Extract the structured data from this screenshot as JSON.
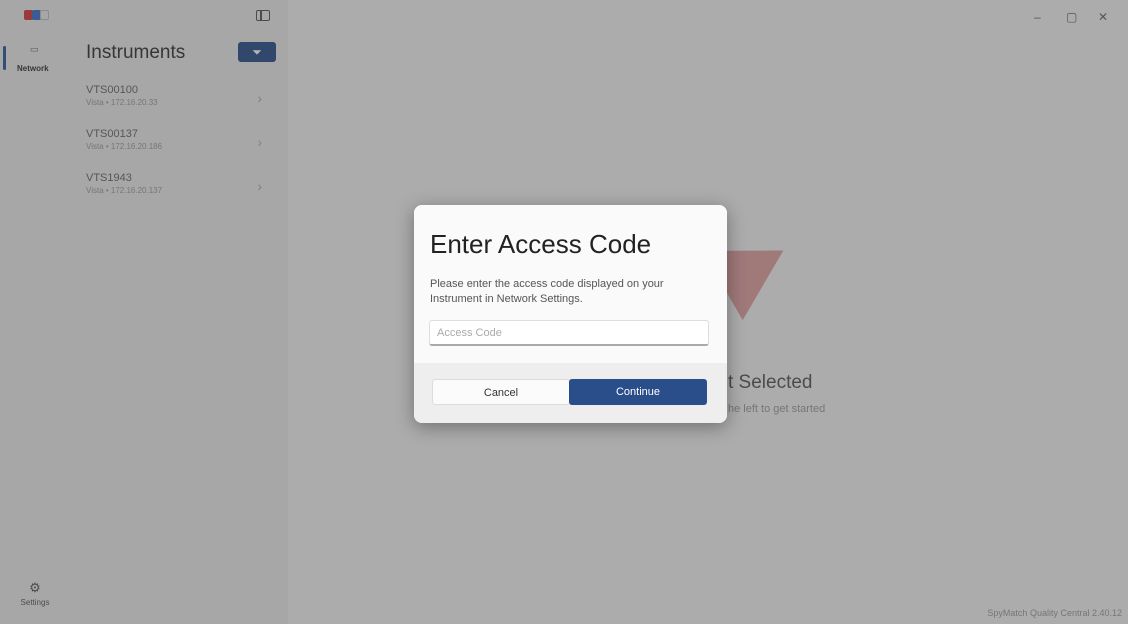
{
  "rail": {
    "network_label": "Network",
    "settings_label": "Settings"
  },
  "panel": {
    "title": "Instruments",
    "instruments": [
      {
        "name": "VTS00100",
        "sub": "Vista • 172.16.20.33"
      },
      {
        "name": "VTS00137",
        "sub": "Vista • 172.16.20.186"
      },
      {
        "name": "VTS1943",
        "sub": "Vista • 172.16.20.137"
      }
    ]
  },
  "main": {
    "empty_title": "t Selected",
    "empty_sub": "he left to get started",
    "version": "SpyMatch Quality Central 2.40.12"
  },
  "dialog": {
    "title": "Enter Access Code",
    "message": "Please enter the access code displayed on your Instrument in Network Settings.",
    "input_placeholder": "Access Code",
    "input_value": "",
    "cancel_label": "Cancel",
    "continue_label": "Continue"
  },
  "colors": {
    "accent": "#2a4e8a",
    "overlay": "#3c3c3c"
  },
  "icons": [
    "panel-toggle-icon",
    "filter-icon",
    "chevron-right-icon",
    "settings-gear-icon",
    "minimize-icon",
    "maximize-icon",
    "close-icon"
  ]
}
